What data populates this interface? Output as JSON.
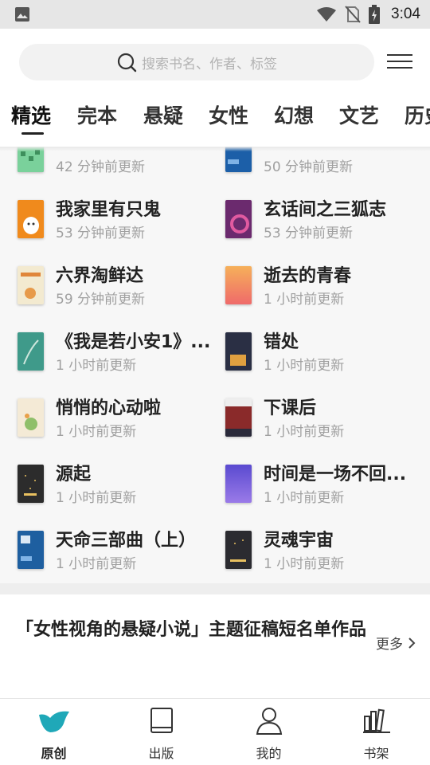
{
  "status_bar": {
    "time": "3:04",
    "icons": [
      "image-icon",
      "wifi-icon",
      "no-sim-icon",
      "battery-charging-icon"
    ]
  },
  "search": {
    "placeholder": "搜索书名、作者、标签"
  },
  "tabs": [
    {
      "label": "精选",
      "active": true
    },
    {
      "label": "完本",
      "active": false
    },
    {
      "label": "悬疑",
      "active": false
    },
    {
      "label": "女性",
      "active": false
    },
    {
      "label": "幻想",
      "active": false
    },
    {
      "label": "文艺",
      "active": false
    },
    {
      "label": "历史",
      "active": false
    }
  ],
  "books": [
    {
      "title": "",
      "updated": "42 分钟前更新",
      "cover": "#4caf72"
    },
    {
      "title": "",
      "updated": "50 分钟前更新",
      "cover": "#1c5fa8"
    },
    {
      "title": "我家里有只鬼",
      "updated": "53 分钟前更新",
      "cover": "#f08a1c"
    },
    {
      "title": "玄话间之三狐志",
      "updated": "53 分钟前更新",
      "cover": "#6b2a6e"
    },
    {
      "title": "六界淘鲜达",
      "updated": "59 分钟前更新",
      "cover": "#f3ead0"
    },
    {
      "title": "逝去的青春",
      "updated": "1 小时前更新",
      "cover": "#f39a4a"
    },
    {
      "title": "《我是若小安1》...",
      "updated": "1 小时前更新",
      "cover": "#3f9a8a"
    },
    {
      "title": "错处",
      "updated": "1 小时前更新",
      "cover": "#2a2f44"
    },
    {
      "title": "悄悄的心动啦",
      "updated": "1 小时前更新",
      "cover": "#f4ead6"
    },
    {
      "title": "下课后",
      "updated": "1 小时前更新",
      "cover": "#8a2a2a"
    },
    {
      "title": "源起",
      "updated": "1 小时前更新",
      "cover": "#2c2c2c"
    },
    {
      "title": "时间是一场不回...",
      "updated": "1 小时前更新",
      "cover": "#7a5ad8"
    },
    {
      "title": "天命三部曲（上）",
      "updated": "1 小时前更新",
      "cover": "#1e5fa0"
    },
    {
      "title": "灵魂宇宙",
      "updated": "1 小时前更新",
      "cover": "#2b2b30"
    }
  ],
  "section": {
    "title": "「女性视角的悬疑小说」主题征稿短名单作品",
    "more": "更多"
  },
  "bottom_nav": [
    {
      "label": "原创",
      "icon": "bird-icon",
      "active": true
    },
    {
      "label": "出版",
      "icon": "book-icon",
      "active": false
    },
    {
      "label": "我的",
      "icon": "person-icon",
      "active": false
    },
    {
      "label": "书架",
      "icon": "bookshelf-icon",
      "active": false
    }
  ]
}
